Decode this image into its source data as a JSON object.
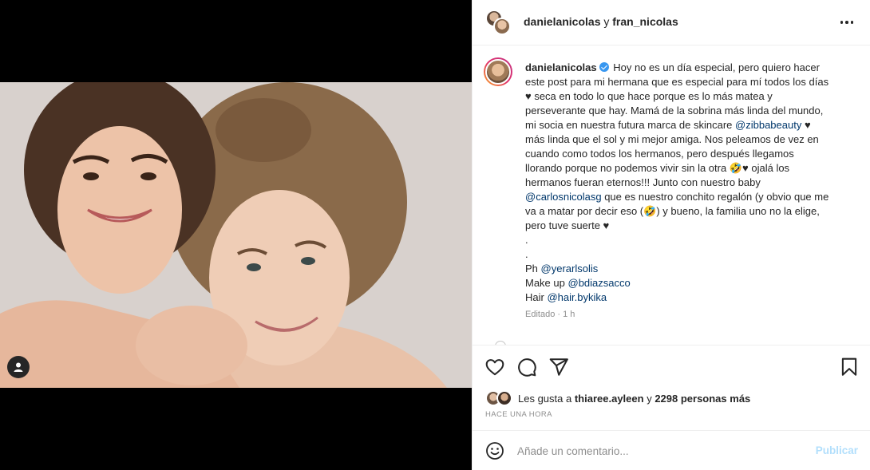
{
  "header": {
    "user1": "danielanicolas",
    "joiner": "y",
    "user2": "fran_nicolas",
    "more_icon": "more-horizontal-icon"
  },
  "caption": {
    "username": "danielanicolas",
    "lines": [
      "Hoy no es un día especial, pero quiero hacer",
      "este post para mi hermana que es especial para mí todos los días",
      "♥ seca en todo lo que hace porque es lo más matea y",
      "perseverante que hay. Mamá de la sobrina más linda del mundo,",
      "mi socia en nuestra futura marca de skincare",
      "más linda que el sol y mi mejor amiga. Nos peleamos de vez en",
      "cuando como todos los hermanos, pero después llegamos",
      "llorando porque no podemos vivir sin la otra",
      "ojalá los",
      "hermanos fueran eternos!!! Junto con nuestro baby",
      "que es nuestro conchito regalón (y obvio que me",
      "va a matar por decir eso",
      ") y bueno, la familia uno no la elige,",
      "pero tuve suerte ♥",
      ".",
      ".",
      "Ph",
      "Make up",
      "Hair"
    ],
    "mentions": {
      "zibba": "@zibbabeauty",
      "carlos": "@carlosnicolasg",
      "photographer": "@yerarlsolis",
      "makeup": "@bdiazsacco",
      "hair": "@hair.bykika"
    },
    "emoji": "🤣",
    "heart": "♥",
    "edited": "Editado · 1 h"
  },
  "actions": {
    "like_icon": "heart-icon",
    "comment_icon": "comment-icon",
    "share_icon": "send-icon",
    "save_icon": "bookmark-icon"
  },
  "likes": {
    "prefix": "Les gusta a",
    "first_user": "thiaree.ayleen",
    "joiner": "y",
    "others": "2298 personas más"
  },
  "time_ago": "HACE UNA HORA",
  "comment": {
    "placeholder": "Añade un comentario...",
    "publish": "Publicar",
    "emoji_icon": "smiley-icon"
  },
  "colors": {
    "mention": "#00376b",
    "publish_disabled": "#b2dffc",
    "verified": "#3897f0",
    "muted": "#8e8e8e"
  }
}
